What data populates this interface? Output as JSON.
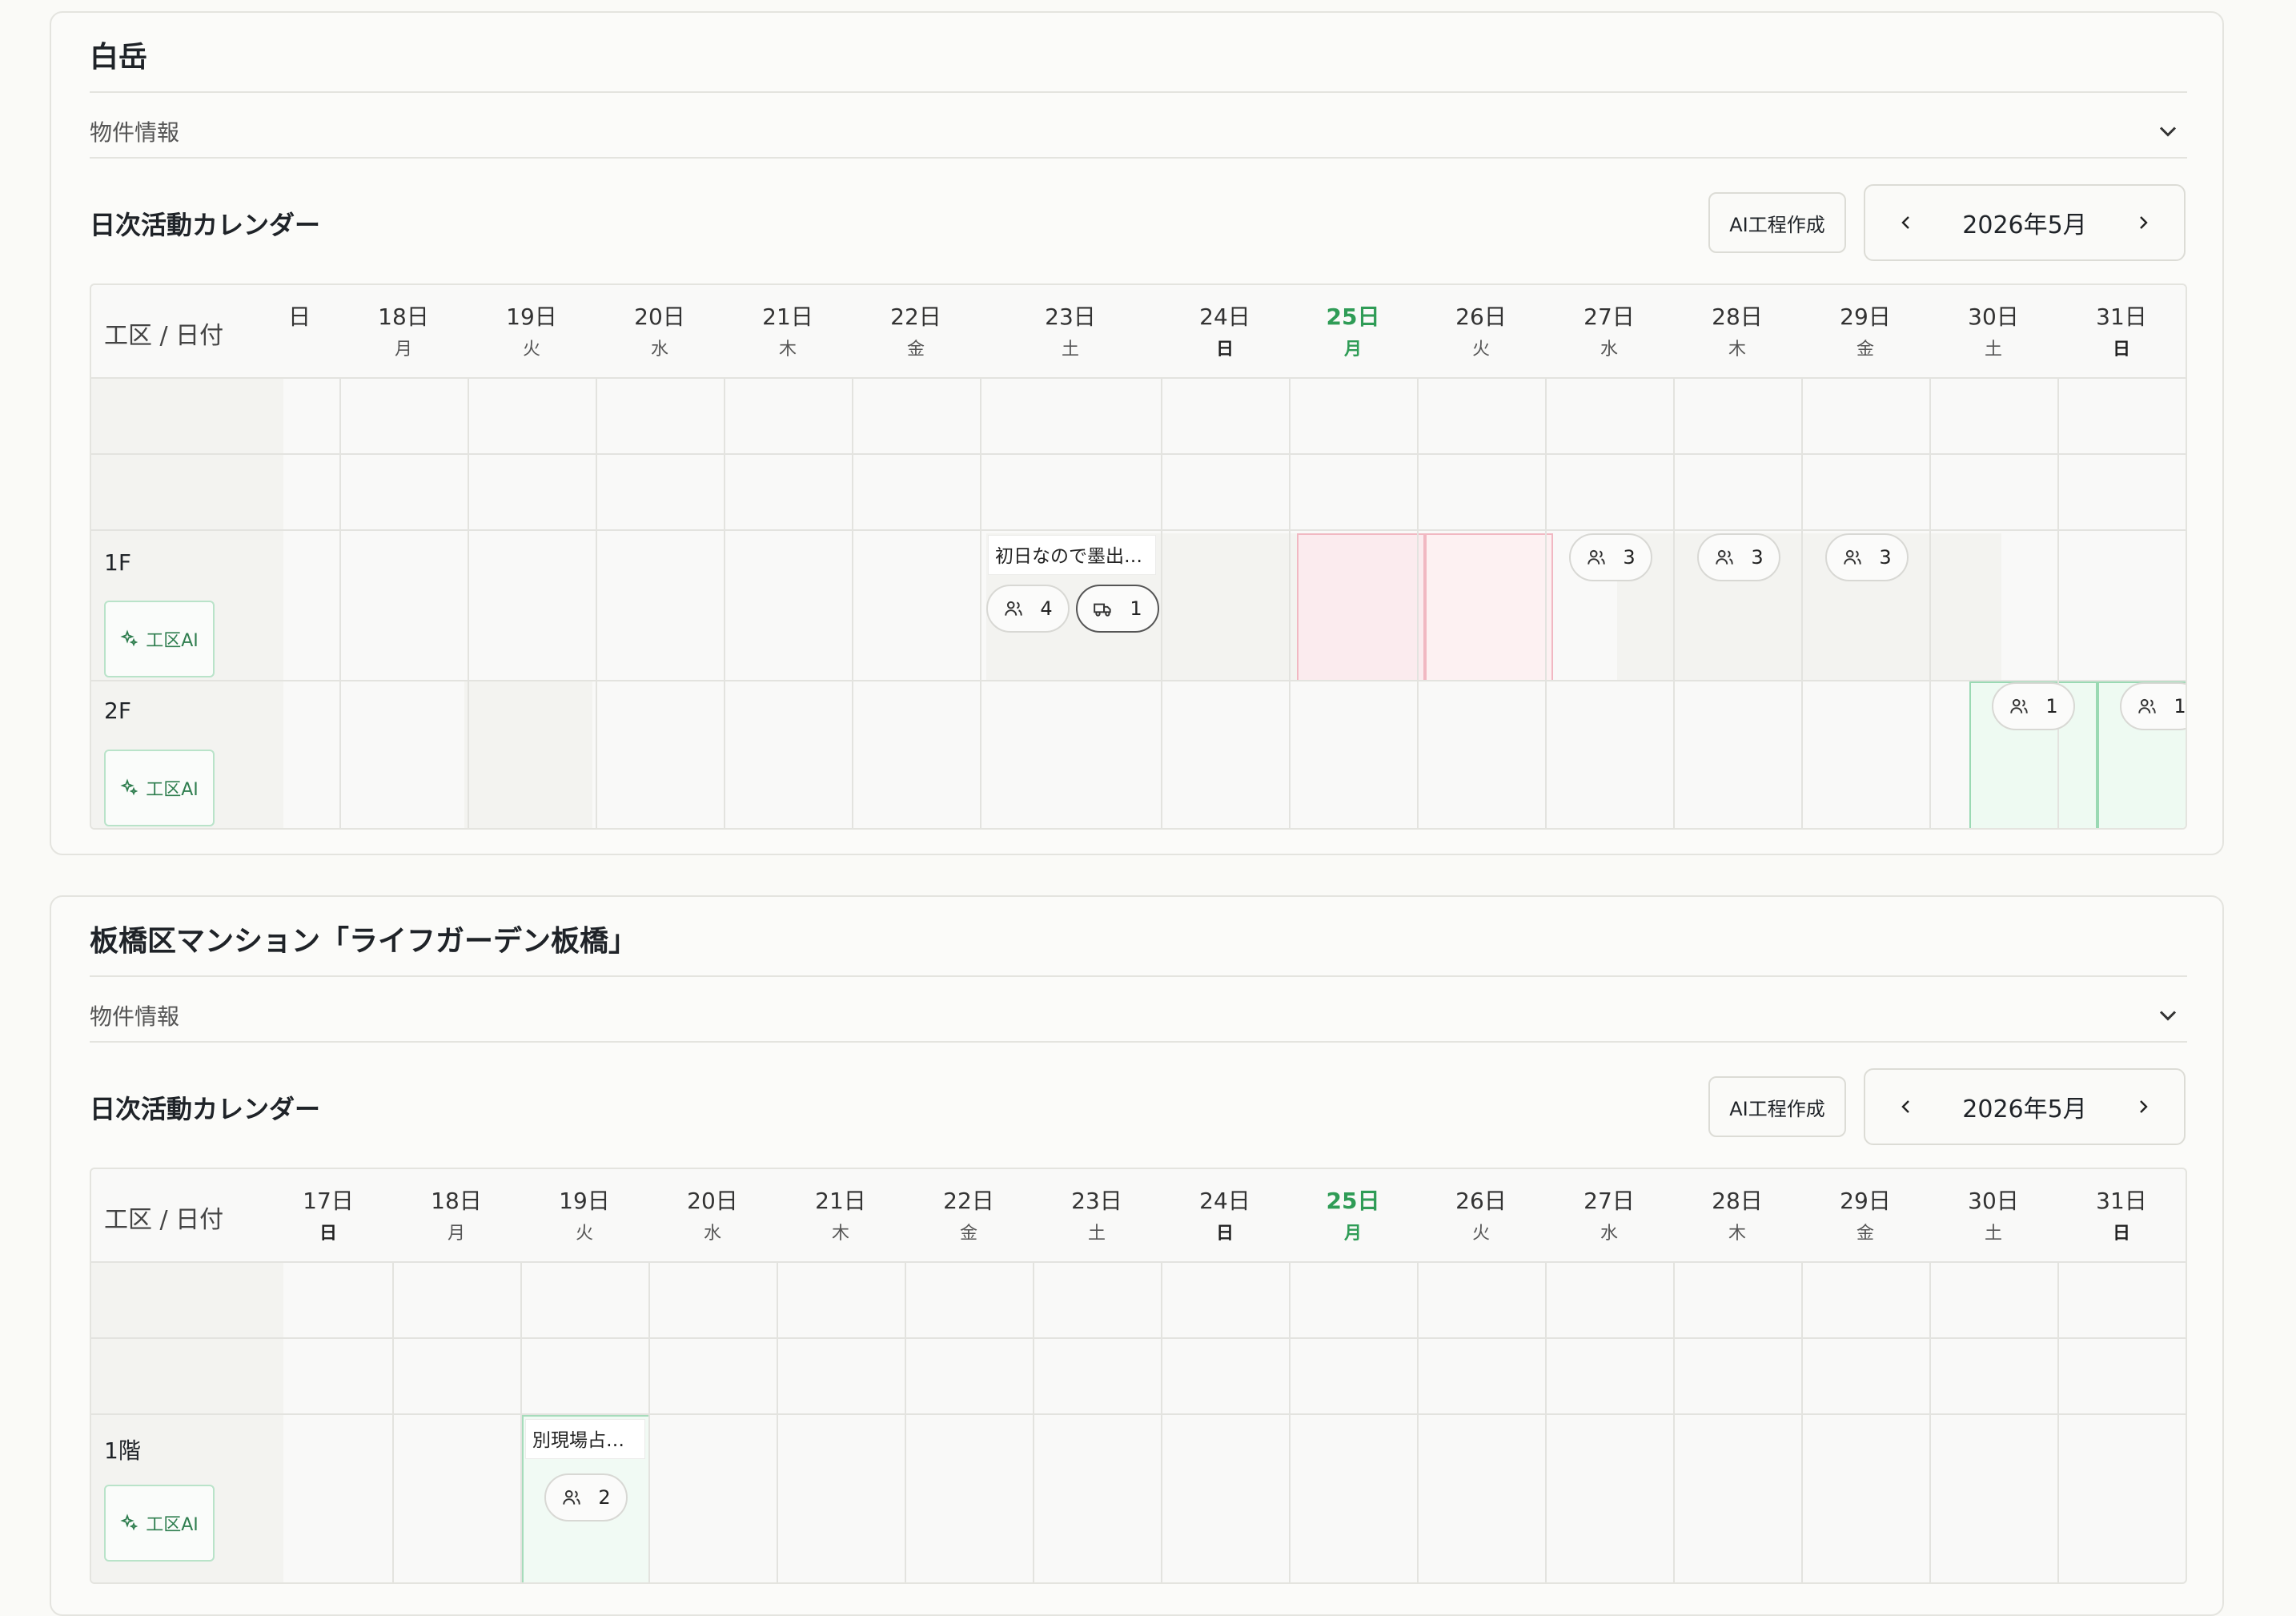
{
  "projects": [
    {
      "title": "白岳",
      "property_info_label": "物件情報",
      "calendar_title": "日次活動カレンダー",
      "ai_schedule_button": "AI工程作成",
      "month_label": "2026年5月",
      "header_label": "工区 / 日付",
      "days": [
        {
          "d": "日",
          "w": ""
        },
        {
          "d": "18日",
          "w": "月"
        },
        {
          "d": "19日",
          "w": "火"
        },
        {
          "d": "20日",
          "w": "水"
        },
        {
          "d": "21日",
          "w": "木"
        },
        {
          "d": "22日",
          "w": "金"
        },
        {
          "d": "23日",
          "w": "土"
        },
        {
          "d": "24日",
          "w": "日"
        },
        {
          "d": "25日",
          "w": "月"
        },
        {
          "d": "26日",
          "w": "火"
        },
        {
          "d": "27日",
          "w": "水"
        },
        {
          "d": "28日",
          "w": "木"
        },
        {
          "d": "29日",
          "w": "金"
        },
        {
          "d": "30日",
          "w": "土"
        },
        {
          "d": "31日",
          "w": "日"
        }
      ],
      "zones": [
        {
          "name": "1F",
          "ai_label": "工区AI"
        },
        {
          "name": "2F",
          "ai_label": "工区AI"
        }
      ],
      "events": {
        "note_23": "初日なので墨出…",
        "workers_23": "4",
        "trucks_23": "1",
        "workers_27": "3",
        "workers_28": "3",
        "workers_29": "3",
        "workers_30": "1",
        "workers_31": "1"
      }
    },
    {
      "title": "板橋区マンション「ライフガーデン板橋」",
      "property_info_label": "物件情報",
      "calendar_title": "日次活動カレンダー",
      "ai_schedule_button": "AI工程作成",
      "month_label": "2026年5月",
      "header_label": "工区 / 日付",
      "days": [
        {
          "d": "17日",
          "w": "日"
        },
        {
          "d": "18日",
          "w": "月"
        },
        {
          "d": "19日",
          "w": "火"
        },
        {
          "d": "20日",
          "w": "水"
        },
        {
          "d": "21日",
          "w": "木"
        },
        {
          "d": "22日",
          "w": "金"
        },
        {
          "d": "23日",
          "w": "土"
        },
        {
          "d": "24日",
          "w": "日"
        },
        {
          "d": "25日",
          "w": "月"
        },
        {
          "d": "26日",
          "w": "火"
        },
        {
          "d": "27日",
          "w": "水"
        },
        {
          "d": "28日",
          "w": "木"
        },
        {
          "d": "29日",
          "w": "金"
        },
        {
          "d": "30日",
          "w": "土"
        },
        {
          "d": "31日",
          "w": "日"
        }
      ],
      "zones": [
        {
          "name": "1階",
          "ai_label": "工区AI"
        }
      ],
      "events": {
        "note_19": "別現場占…",
        "workers_19": "2"
      }
    }
  ],
  "colors": {
    "today": "#2f9c56",
    "accent_green": "#2f7e4f",
    "warning_pink": "#f1b8c2"
  }
}
